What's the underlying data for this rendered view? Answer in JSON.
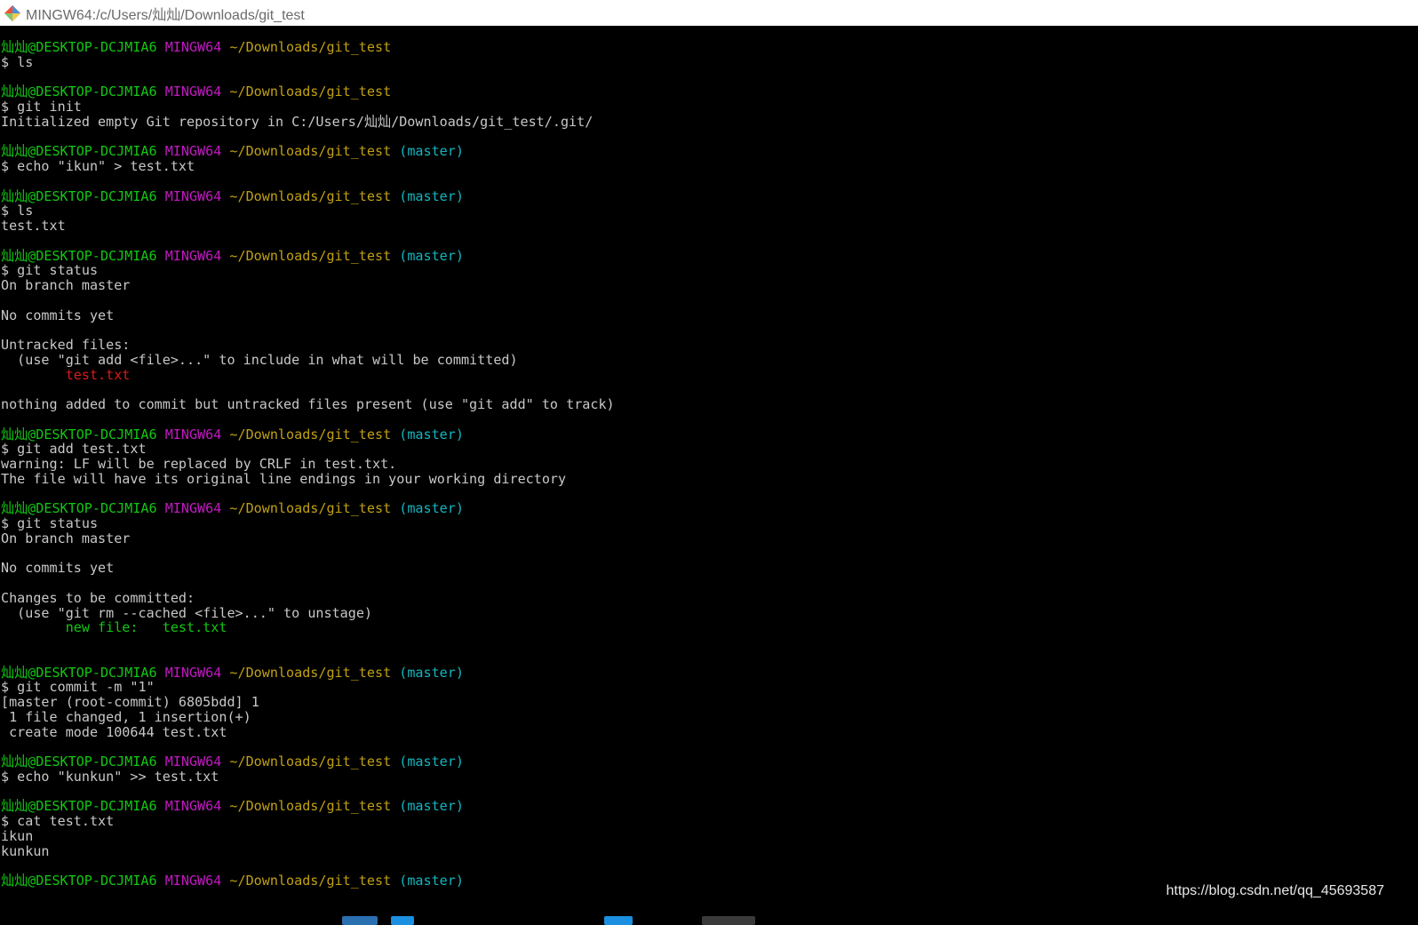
{
  "window": {
    "title": "MINGW64:/c/Users/灿灿/Downloads/git_test",
    "icon": "git-bash-icon"
  },
  "colors": {
    "background": "#000000",
    "default_text": "#c8c8c8",
    "user_host": "#13c713",
    "system": "#c319c3",
    "path": "#c1a112",
    "branch": "#14b6c1",
    "untracked": "#dc1a1a",
    "staged": "#13c713"
  },
  "terminal": {
    "lines": [
      {
        "type": "prompt",
        "user": "灿灿@DESKTOP-DCJMIA6",
        "system": "MINGW64",
        "path": "~/Downloads/git_test",
        "branch": ""
      },
      {
        "type": "text",
        "text": "$ ls"
      },
      {
        "type": "text",
        "text": ""
      },
      {
        "type": "prompt",
        "user": "灿灿@DESKTOP-DCJMIA6",
        "system": "MINGW64",
        "path": "~/Downloads/git_test",
        "branch": ""
      },
      {
        "type": "text",
        "text": "$ git init"
      },
      {
        "type": "text",
        "text": "Initialized empty Git repository in C:/Users/灿灿/Downloads/git_test/.git/"
      },
      {
        "type": "text",
        "text": ""
      },
      {
        "type": "prompt",
        "user": "灿灿@DESKTOP-DCJMIA6",
        "system": "MINGW64",
        "path": "~/Downloads/git_test",
        "branch": "(master)"
      },
      {
        "type": "text",
        "text": "$ echo \"ikun\" > test.txt"
      },
      {
        "type": "text",
        "text": ""
      },
      {
        "type": "prompt",
        "user": "灿灿@DESKTOP-DCJMIA6",
        "system": "MINGW64",
        "path": "~/Downloads/git_test",
        "branch": "(master)"
      },
      {
        "type": "text",
        "text": "$ ls"
      },
      {
        "type": "text",
        "text": "test.txt"
      },
      {
        "type": "text",
        "text": ""
      },
      {
        "type": "prompt",
        "user": "灿灿@DESKTOP-DCJMIA6",
        "system": "MINGW64",
        "path": "~/Downloads/git_test",
        "branch": "(master)"
      },
      {
        "type": "text",
        "text": "$ git status"
      },
      {
        "type": "text",
        "text": "On branch master"
      },
      {
        "type": "text",
        "text": ""
      },
      {
        "type": "text",
        "text": "No commits yet"
      },
      {
        "type": "text",
        "text": ""
      },
      {
        "type": "text",
        "text": "Untracked files:"
      },
      {
        "type": "text",
        "text": "  (use \"git add <file>...\" to include in what will be committed)"
      },
      {
        "type": "colored",
        "color": "red",
        "text": "        test.txt"
      },
      {
        "type": "text",
        "text": ""
      },
      {
        "type": "text",
        "text": "nothing added to commit but untracked files present (use \"git add\" to track)"
      },
      {
        "type": "text",
        "text": ""
      },
      {
        "type": "prompt",
        "user": "灿灿@DESKTOP-DCJMIA6",
        "system": "MINGW64",
        "path": "~/Downloads/git_test",
        "branch": "(master)"
      },
      {
        "type": "text",
        "text": "$ git add test.txt"
      },
      {
        "type": "text",
        "text": "warning: LF will be replaced by CRLF in test.txt."
      },
      {
        "type": "text",
        "text": "The file will have its original line endings in your working directory"
      },
      {
        "type": "text",
        "text": ""
      },
      {
        "type": "prompt",
        "user": "灿灿@DESKTOP-DCJMIA6",
        "system": "MINGW64",
        "path": "~/Downloads/git_test",
        "branch": "(master)"
      },
      {
        "type": "text",
        "text": "$ git status"
      },
      {
        "type": "text",
        "text": "On branch master"
      },
      {
        "type": "text",
        "text": ""
      },
      {
        "type": "text",
        "text": "No commits yet"
      },
      {
        "type": "text",
        "text": ""
      },
      {
        "type": "text",
        "text": "Changes to be committed:"
      },
      {
        "type": "text",
        "text": "  (use \"git rm --cached <file>...\" to unstage)"
      },
      {
        "type": "colored",
        "color": "green",
        "text": "        new file:   test.txt"
      },
      {
        "type": "text",
        "text": ""
      },
      {
        "type": "text",
        "text": ""
      },
      {
        "type": "prompt",
        "user": "灿灿@DESKTOP-DCJMIA6",
        "system": "MINGW64",
        "path": "~/Downloads/git_test",
        "branch": "(master)"
      },
      {
        "type": "text",
        "text": "$ git commit -m \"1\""
      },
      {
        "type": "text",
        "text": "[master (root-commit) 6805bdd] 1"
      },
      {
        "type": "text",
        "text": " 1 file changed, 1 insertion(+)"
      },
      {
        "type": "text",
        "text": " create mode 100644 test.txt"
      },
      {
        "type": "text",
        "text": ""
      },
      {
        "type": "prompt",
        "user": "灿灿@DESKTOP-DCJMIA6",
        "system": "MINGW64",
        "path": "~/Downloads/git_test",
        "branch": "(master)"
      },
      {
        "type": "text",
        "text": "$ echo \"kunkun\" >> test.txt"
      },
      {
        "type": "text",
        "text": ""
      },
      {
        "type": "prompt",
        "user": "灿灿@DESKTOP-DCJMIA6",
        "system": "MINGW64",
        "path": "~/Downloads/git_test",
        "branch": "(master)"
      },
      {
        "type": "text",
        "text": "$ cat test.txt"
      },
      {
        "type": "text",
        "text": "ikun"
      },
      {
        "type": "text",
        "text": "kunkun"
      },
      {
        "type": "text",
        "text": ""
      },
      {
        "type": "prompt",
        "user": "灿灿@DESKTOP-DCJMIA6",
        "system": "MINGW64",
        "path": "~/Downloads/git_test",
        "branch": "(master)"
      }
    ]
  },
  "watermark": "https://blog.csdn.net/qq_45693587"
}
